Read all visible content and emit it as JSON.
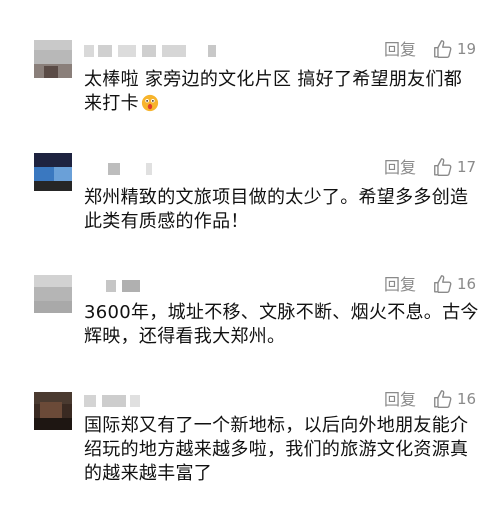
{
  "comments": [
    {
      "reply_label": "回复",
      "likes": "19",
      "text_lines": [
        "太棒啦 家旁边的文化片区 搞好了希望朋友们都",
        "来打卡"
      ],
      "emoji": "surprised-face-emoji"
    },
    {
      "reply_label": "回复",
      "likes": "17",
      "text_lines": [
        "郑州精致的文旅项目做的太少了。希望多多创造",
        "此类有质感的作品！"
      ]
    },
    {
      "reply_label": "回复",
      "likes": "16",
      "text_lines": [
        "3600年，城址不移、文脉不断、烟火不息。古今",
        "辉映，还得看我大郑州。"
      ]
    },
    {
      "reply_label": "回复",
      "likes": "16",
      "text_lines": [
        "国际郑又有了一个新地标，以后向外地朋友能介",
        "绍玩的地方越来越多啦，我们的旅游文化资源真",
        "的越来越丰富了"
      ]
    }
  ],
  "icons": {
    "like": "thumbs-up-outline-icon"
  },
  "colors": {
    "text": "#111111",
    "meta": "#8a8a8a"
  }
}
